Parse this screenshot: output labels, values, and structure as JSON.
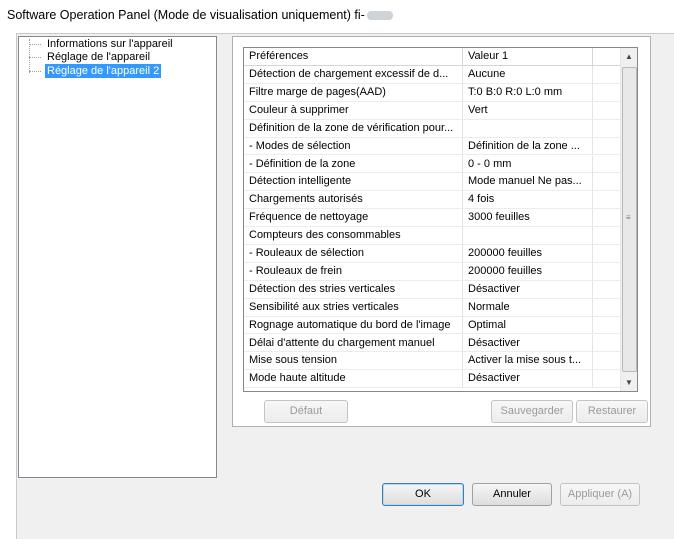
{
  "window": {
    "title": "Software Operation Panel (Mode de visualisation uniquement) fi-"
  },
  "tree": {
    "items": [
      {
        "label": "Informations sur l'appareil",
        "selected": false
      },
      {
        "label": "Réglage de l'appareil",
        "selected": false
      },
      {
        "label": "Réglage de l'appareil 2",
        "selected": true
      }
    ]
  },
  "grid": {
    "headers": [
      "Préférences",
      "Valeur 1",
      ""
    ],
    "rows": [
      {
        "name": "Détection de chargement excessif de d...",
        "value": "Aucune"
      },
      {
        "name": "Filtre marge de pages(AAD)",
        "value": "T:0  B:0  R:0  L:0 mm"
      },
      {
        "name": "Couleur à supprimer",
        "value": "Vert"
      },
      {
        "name": "Définition de la zone de vérification pour...",
        "value": ""
      },
      {
        "name": " - Modes de sélection",
        "value": "Définition de la zone ..."
      },
      {
        "name": " - Définition de la zone",
        "value": "0 - 0 mm"
      },
      {
        "name": "Détection intelligente",
        "value": "Mode manuel  Ne pas..."
      },
      {
        "name": "Chargements autorisés",
        "value": "4 fois"
      },
      {
        "name": "Fréquence de nettoyage",
        "value": "3000 feuilles"
      },
      {
        "name": "Compteurs des consommables",
        "value": ""
      },
      {
        "name": " - Rouleaux de sélection",
        "value": "200000 feuilles"
      },
      {
        "name": " - Rouleaux de frein",
        "value": "200000 feuilles"
      },
      {
        "name": "Détection des stries verticales",
        "value": "Désactiver"
      },
      {
        "name": "Sensibilité aux stries verticales",
        "value": "Normale"
      },
      {
        "name": "Rognage automatique du bord de l'image",
        "value": "Optimal"
      },
      {
        "name": "Délai d'attente du chargement manuel",
        "value": "Désactiver"
      },
      {
        "name": "Mise sous tension",
        "value": "Activer la mise sous t..."
      },
      {
        "name": "Mode haute altitude",
        "value": "Désactiver"
      }
    ],
    "scrollbar": {
      "up_arrow": "▲",
      "down_arrow": "▼",
      "grip": "≡"
    }
  },
  "buttons": {
    "default": "Défaut",
    "save": "Sauvegarder",
    "restore": "Restaurer",
    "ok": "OK",
    "cancel": "Annuler",
    "apply": "Appliquer (A)"
  },
  "colors": {
    "selection": "#3399ff",
    "dialog_bg": "#f0f0f0"
  }
}
